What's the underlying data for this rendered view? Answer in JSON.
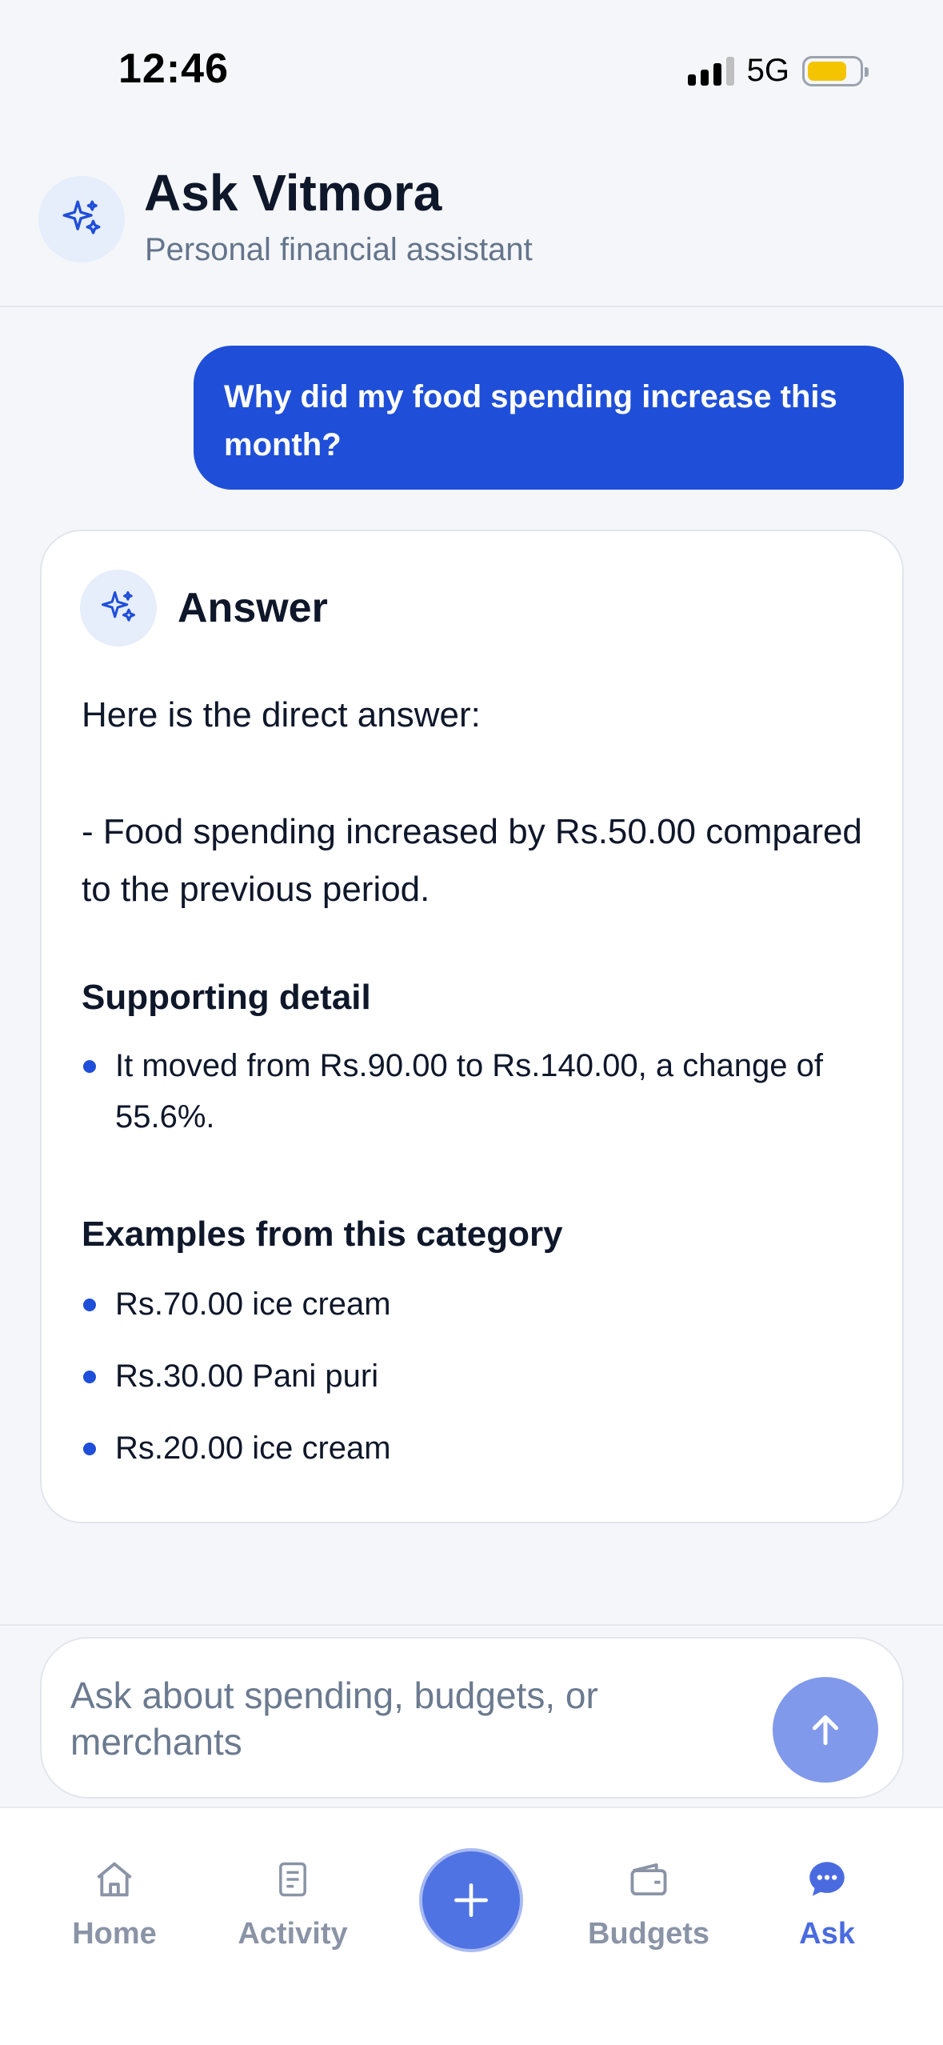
{
  "status_bar": {
    "time": "12:46",
    "network": "5G"
  },
  "header": {
    "title": "Ask Vitmora",
    "subtitle": "Personal financial assistant",
    "icon": "sparkles-icon"
  },
  "conversation": {
    "user_message": "Why did my food spending increase this month?",
    "answer": {
      "title": "Answer",
      "intro": "Here is the direct answer:",
      "summary": "- Food spending increased by Rs.50.00 compared to the previous period.",
      "supporting_heading": "Supporting detail",
      "supporting_items": [
        "It moved from Rs.90.00 to Rs.140.00, a change of 55.6%."
      ],
      "examples_heading": "Examples from this category",
      "examples": [
        "Rs.70.00 ice cream",
        "Rs.30.00 Pani puri",
        "Rs.20.00 ice cream"
      ]
    }
  },
  "composer": {
    "placeholder": "Ask about spending, budgets, or merchants",
    "send_icon": "arrow-up-icon"
  },
  "tab_bar": {
    "items": [
      {
        "label": "Home",
        "icon": "home-icon",
        "active": false
      },
      {
        "label": "Activity",
        "icon": "document-icon",
        "active": false
      },
      {
        "label": "Budgets",
        "icon": "wallet-icon",
        "active": false
      },
      {
        "label": "Ask",
        "icon": "chat-bubble-icon",
        "active": true
      }
    ],
    "center_action_icon": "plus-icon"
  },
  "colors": {
    "accent": "#1f4fd8",
    "accent_light": "#e6edfb",
    "send_button": "#8199ea",
    "active_tab": "#4a6be0",
    "inactive_tab": "#8a94a6",
    "battery": "#f5c400"
  }
}
